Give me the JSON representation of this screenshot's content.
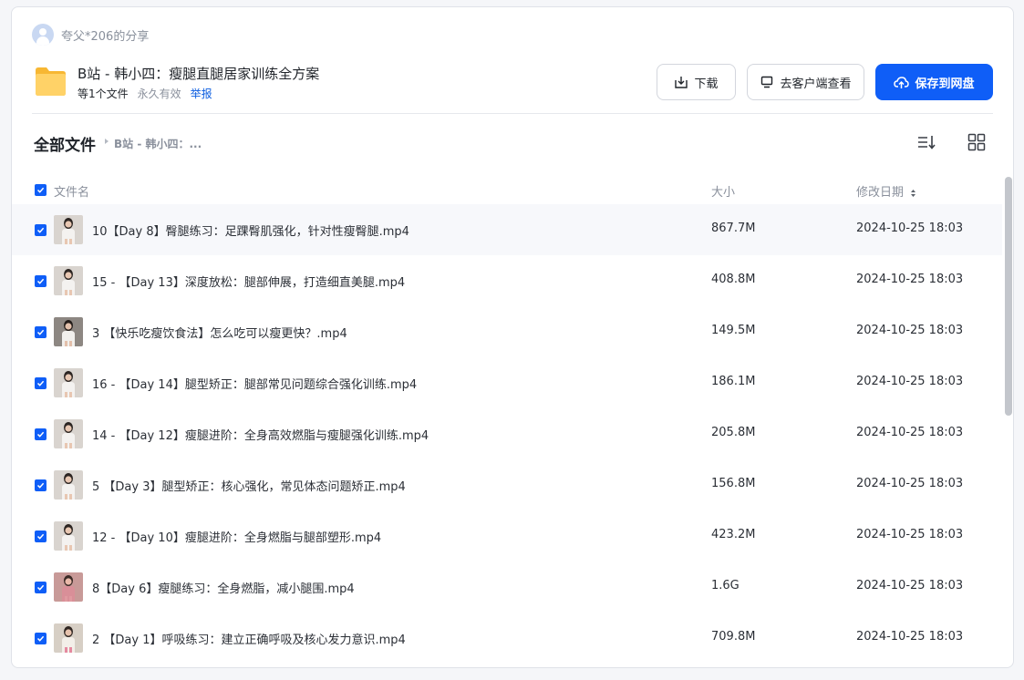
{
  "sharer": {
    "name": "夸父*206的分享",
    "icon": "user-avatar-icon"
  },
  "share": {
    "title": "B站 - 韩小四：瘦腿直腿居家训练全方案",
    "file_count": "等1个文件",
    "validity": "永久有效",
    "report": "举报"
  },
  "actions": {
    "download": "下载",
    "open_client": "去客户端查看",
    "save": "保存到网盘"
  },
  "breadcrumb": {
    "root": "全部文件",
    "current": "B站 - 韩小四：..."
  },
  "table": {
    "headers": {
      "name": "文件名",
      "size": "大小",
      "modified": "修改日期"
    },
    "rows": [
      {
        "name": "10【Day 8】臀腿练习：足踝臀肌强化，针对性瘦臀腿.mp4",
        "size": "867.7M",
        "date": "2024-10-25 18:03",
        "checked": true,
        "thumb": "white-top"
      },
      {
        "name": "15 - 【Day 13】深度放松：腿部伸展，打造细直美腿.mp4",
        "size": "408.8M",
        "date": "2024-10-25 18:03",
        "checked": true,
        "thumb": "white-top"
      },
      {
        "name": "3 【快乐吃瘦饮食法】怎么吃可以瘦更快？.mp4",
        "size": "149.5M",
        "date": "2024-10-25 18:03",
        "checked": true,
        "thumb": "white-top-dark"
      },
      {
        "name": "16 - 【Day 14】腿型矫正：腿部常见问题综合强化训练.mp4",
        "size": "186.1M",
        "date": "2024-10-25 18:03",
        "checked": true,
        "thumb": "white-top"
      },
      {
        "name": "14 - 【Day 12】瘦腿进阶：全身高效燃脂与瘦腿强化训练.mp4",
        "size": "205.8M",
        "date": "2024-10-25 18:03",
        "checked": true,
        "thumb": "white-top"
      },
      {
        "name": "5 【Day 3】腿型矫正：核心强化，常见体态问题矫正.mp4",
        "size": "156.8M",
        "date": "2024-10-25 18:03",
        "checked": true,
        "thumb": "white-top"
      },
      {
        "name": "12 - 【Day 10】瘦腿进阶：全身燃脂与腿部塑形.mp4",
        "size": "423.2M",
        "date": "2024-10-25 18:03",
        "checked": true,
        "thumb": "white-top"
      },
      {
        "name": "8【Day 6】瘦腿练习：全身燃脂，减小腿围.mp4",
        "size": "1.6G",
        "date": "2024-10-25 18:03",
        "checked": true,
        "thumb": "pink-full"
      },
      {
        "name": "2 【Day 1】呼吸练习：建立正确呼吸及核心发力意识.mp4",
        "size": "709.8M",
        "date": "2024-10-25 18:03",
        "checked": true,
        "thumb": "pink-shorts"
      }
    ]
  },
  "icons": {
    "folder": "folder-icon",
    "download": "download-icon",
    "client": "monitor-icon",
    "save": "cloud-upload-icon",
    "sort": "sort-list-icon",
    "grid": "grid-view-icon",
    "checkbox": "checkbox-checked-icon",
    "date_sort": "sort-toggle-icon"
  },
  "colors": {
    "primary": "#0f5ef7",
    "folder": "#ffd267",
    "link": "#0b5de0"
  }
}
